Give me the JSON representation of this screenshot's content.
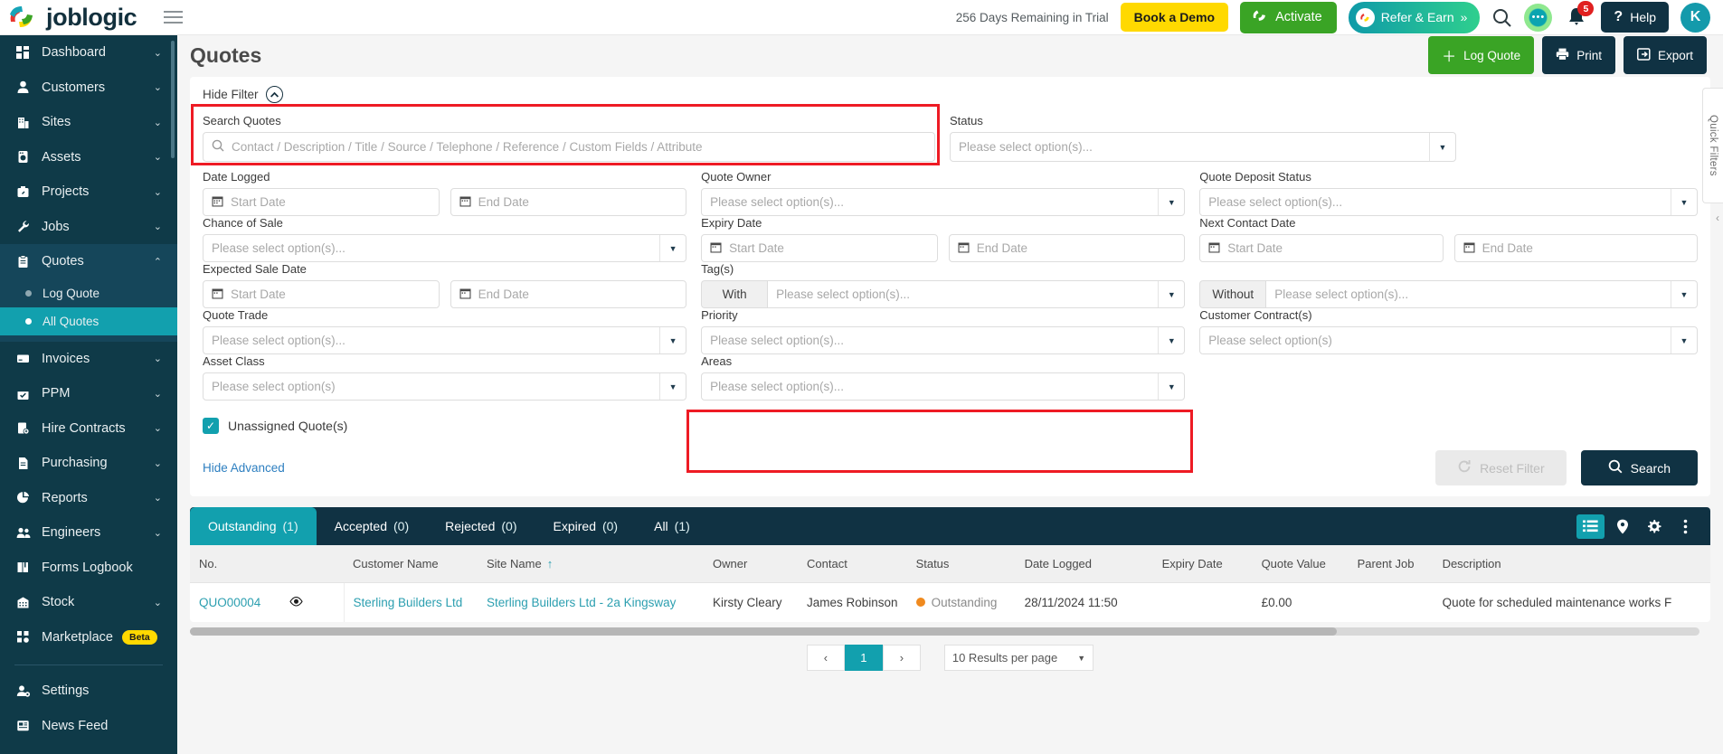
{
  "brand": {
    "name": "joblogic",
    "colors": {
      "teal": "#12a0ae",
      "dark": "#103243",
      "green": "#3aa425",
      "yellow": "#ffd900",
      "red_highlight": "#ee1b24",
      "orange": "#f08a1e"
    }
  },
  "topbar": {
    "trial_text": "256 Days Remaining in Trial",
    "book_demo": "Book a Demo",
    "activate": "Activate",
    "refer": "Refer & Earn",
    "refer_chevrons": "»",
    "help": "Help",
    "notification_count": "5",
    "avatar_initial": "K",
    "search_icon": "search-icon",
    "chat_icon": "chat-icon",
    "bell_icon": "bell-icon",
    "menu_icon": "hamburger-icon"
  },
  "sidebar": {
    "items": [
      {
        "label": "Dashboard",
        "icon": "dashboard-icon",
        "chevron": "⌄"
      },
      {
        "label": "Customers",
        "icon": "person-icon",
        "chevron": "⌄"
      },
      {
        "label": "Sites",
        "icon": "building-icon",
        "chevron": "⌄"
      },
      {
        "label": "Assets",
        "icon": "asset-icon",
        "chevron": "⌄"
      },
      {
        "label": "Projects",
        "icon": "projects-icon",
        "chevron": "⌄"
      },
      {
        "label": "Jobs",
        "icon": "wrench-icon",
        "chevron": "⌄"
      },
      {
        "label": "Quotes",
        "icon": "clipboard-icon",
        "chevron": "⌃"
      },
      {
        "label": "Invoices",
        "icon": "invoice-icon",
        "chevron": "⌄"
      },
      {
        "label": "PPM",
        "icon": "calendar-check-icon",
        "chevron": "⌄"
      },
      {
        "label": "Hire Contracts",
        "icon": "contract-icon",
        "chevron": "⌄"
      },
      {
        "label": "Purchasing",
        "icon": "document-icon",
        "chevron": "⌄"
      },
      {
        "label": "Reports",
        "icon": "pie-chart-icon",
        "chevron": "⌄"
      },
      {
        "label": "Engineers",
        "icon": "people-icon",
        "chevron": "⌄"
      },
      {
        "label": "Forms Logbook",
        "icon": "book-icon",
        "chevron": ""
      },
      {
        "label": "Stock",
        "icon": "warehouse-icon",
        "chevron": "⌄"
      },
      {
        "label": "Marketplace",
        "icon": "grid-icon",
        "chevron": "",
        "badge": "Beta"
      },
      {
        "label": "Settings",
        "icon": "settings-person-icon",
        "chevron": ""
      },
      {
        "label": "News Feed",
        "icon": "news-icon",
        "chevron": ""
      }
    ],
    "quotes_sub": [
      {
        "label": "Log Quote",
        "active": false
      },
      {
        "label": "All Quotes",
        "active": true
      }
    ]
  },
  "page": {
    "title": "Quotes",
    "actions": [
      {
        "label": "Log Quote",
        "icon": "plus-icon",
        "style": "green"
      },
      {
        "label": "Print",
        "icon": "printer-icon",
        "style": "dark"
      },
      {
        "label": "Export",
        "icon": "export-icon",
        "style": "dark"
      }
    ],
    "quick_filters_label": "Quick Filters"
  },
  "filter": {
    "hide_filter": "Hide Filter",
    "search_quotes_label": "Search Quotes",
    "search_quotes_placeholder": "Contact / Description / Title / Source / Telephone / Reference / Custom Fields / Attribute",
    "status_label": "Status",
    "status_placeholder": "Please select option(s)...",
    "date_logged_label": "Date Logged",
    "start_date_placeholder": "Start Date",
    "end_date_placeholder": "End Date",
    "quote_owner_label": "Quote Owner",
    "quote_owner_placeholder": "Please select option(s)...",
    "quote_deposit_status_label": "Quote Deposit Status",
    "quote_deposit_status_placeholder": "Please select option(s)...",
    "chance_of_sale_label": "Chance of Sale",
    "chance_of_sale_placeholder": "Please select option(s)...",
    "expiry_date_label": "Expiry Date",
    "next_contact_date_label": "Next Contact Date",
    "expected_sale_date_label": "Expected Sale Date",
    "tags_label": "Tag(s)",
    "tag_with": "With",
    "tag_without": "Without",
    "tag_with_placeholder": "Please select option(s)...",
    "tag_without_placeholder": "Please select option(s)...",
    "quote_trade_label": "Quote Trade",
    "quote_trade_placeholder": "Please select option(s)...",
    "priority_label": "Priority",
    "priority_placeholder": "Please select option(s)...",
    "customer_contracts_label": "Customer Contract(s)",
    "customer_contracts_placeholder": "Please select option(s)",
    "asset_class_label": "Asset Class",
    "asset_class_placeholder": "Please select option(s)",
    "areas_label": "Areas",
    "areas_placeholder": "Please select option(s)...",
    "unassigned_label": "Unassigned Quote(s)",
    "unassigned_checked": true,
    "hide_advanced": "Hide Advanced",
    "reset_filter": "Reset Filter",
    "search": "Search"
  },
  "tabs": [
    {
      "label": "Outstanding",
      "count": "(1)",
      "active": true
    },
    {
      "label": "Accepted",
      "count": "(0)",
      "active": false
    },
    {
      "label": "Rejected",
      "count": "(0)",
      "active": false
    },
    {
      "label": "Expired",
      "count": "(0)",
      "active": false
    },
    {
      "label": "All",
      "count": "(1)",
      "active": false
    }
  ],
  "tab_tools": [
    {
      "icon": "list-view-icon",
      "selected": true
    },
    {
      "icon": "map-pin-icon",
      "selected": false
    },
    {
      "icon": "gear-icon",
      "selected": false
    },
    {
      "icon": "more-vertical-icon",
      "selected": false
    }
  ],
  "table": {
    "columns": [
      "No.",
      "Customer Name",
      "Site Name",
      "Owner",
      "Contact",
      "Status",
      "Date Logged",
      "Expiry Date",
      "Quote Value",
      "Parent Job",
      "Description"
    ],
    "sorted_column": "Site Name",
    "sort_direction": "↑",
    "rows": [
      {
        "no": "QUO00004",
        "eye_icon": "eye-icon",
        "customer_name": "Sterling Builders Ltd",
        "site_name": "Sterling Builders Ltd - 2a Kingsway",
        "owner": "Kirsty Cleary",
        "contact": "James Robinson",
        "status": "Outstanding",
        "date_logged": "28/11/2024 11:50",
        "expiry_date": "",
        "quote_value": "£0.00",
        "parent_job": "",
        "description": "Quote for scheduled maintenance works F"
      }
    ]
  },
  "pagination": {
    "prev": "‹",
    "pages": [
      "1"
    ],
    "next": "›",
    "current": "1",
    "per_page": "10 Results per page"
  }
}
